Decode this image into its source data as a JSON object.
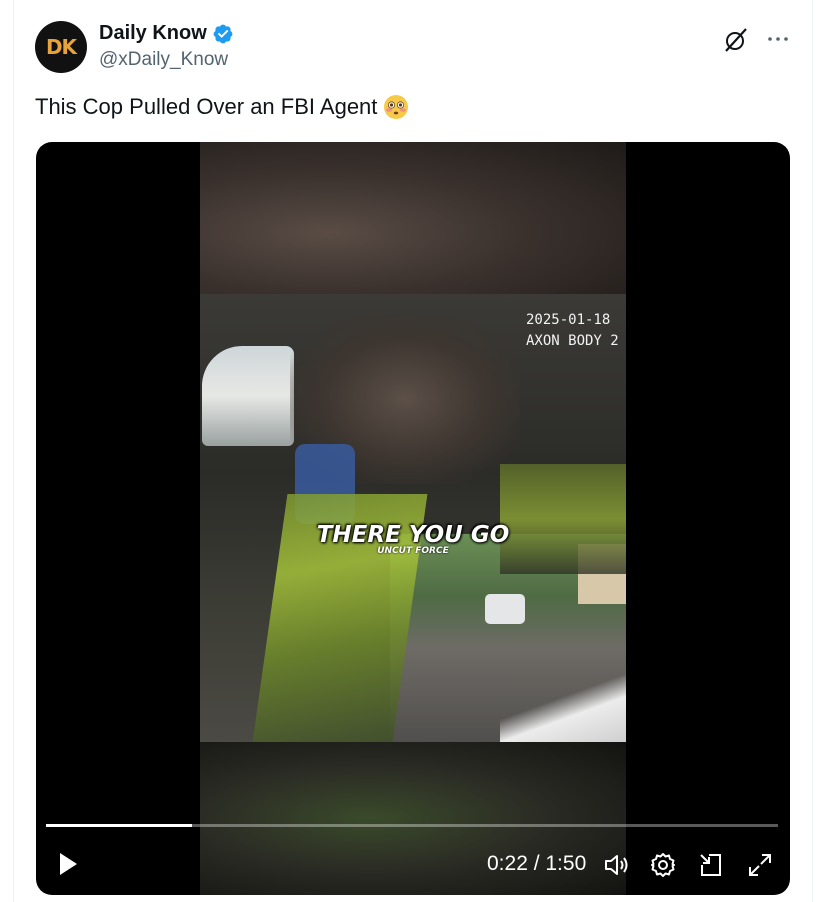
{
  "author": {
    "avatar_text": "DK",
    "display_name": "Daily Know",
    "handle": "@xDaily_Know",
    "verified": true
  },
  "actions": {
    "grok_icon": "grok-icon",
    "more_label": "···"
  },
  "tweet": {
    "text": "This Cop Pulled Over an FBI Agent",
    "emoji": "flushed-face-emoji"
  },
  "video": {
    "overlay_timestamp": "2025-01-18\nAXON BODY 2",
    "caption": "THERE YOU GO",
    "caption_sub": "UNCUT FORCE",
    "current_time": "0:22",
    "duration": "1:50",
    "time_display": "0:22 / 1:50",
    "progress": 0.2
  },
  "colors": {
    "verified_blue": "#1d9bf0",
    "text_primary": "#0f1419",
    "text_secondary": "#536471"
  }
}
